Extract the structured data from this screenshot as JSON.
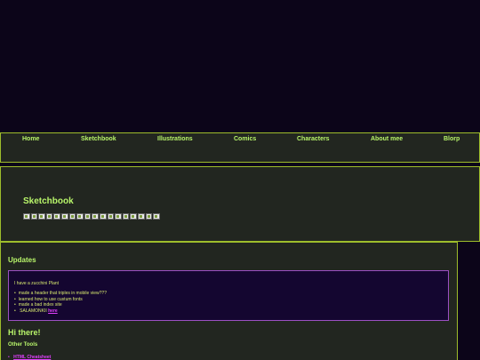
{
  "nav": {
    "items": [
      {
        "label": "Home"
      },
      {
        "label": "Sketchbook"
      },
      {
        "label": "Illustrations"
      },
      {
        "label": "Comics"
      },
      {
        "label": "Characters"
      },
      {
        "label": "About mee"
      },
      {
        "label": "Blorp"
      }
    ]
  },
  "sketchbook": {
    "title": "Sketchbook",
    "thumbnail_count": 18
  },
  "updates": {
    "title": "Updates",
    "intro": "I have a zucchini Plant",
    "items": [
      "made a header that triples in mobile view???",
      "learned how to use custum fonts",
      "made a bad index site",
      "SALAMONKII "
    ],
    "last_item_link": "here"
  },
  "greeting": {
    "title": "Hi there!"
  },
  "tools": {
    "title": "Other Tools",
    "links": [
      "HTML Cheatsheet"
    ]
  },
  "colors": {
    "background": "#0c0519",
    "panel": "#222620",
    "border": "#9ebd2b",
    "heading": "#b8f56a",
    "text": "#d7e86f",
    "link": "#e040fb",
    "update_box": "#140630",
    "update_border": "#9b4fc2"
  }
}
